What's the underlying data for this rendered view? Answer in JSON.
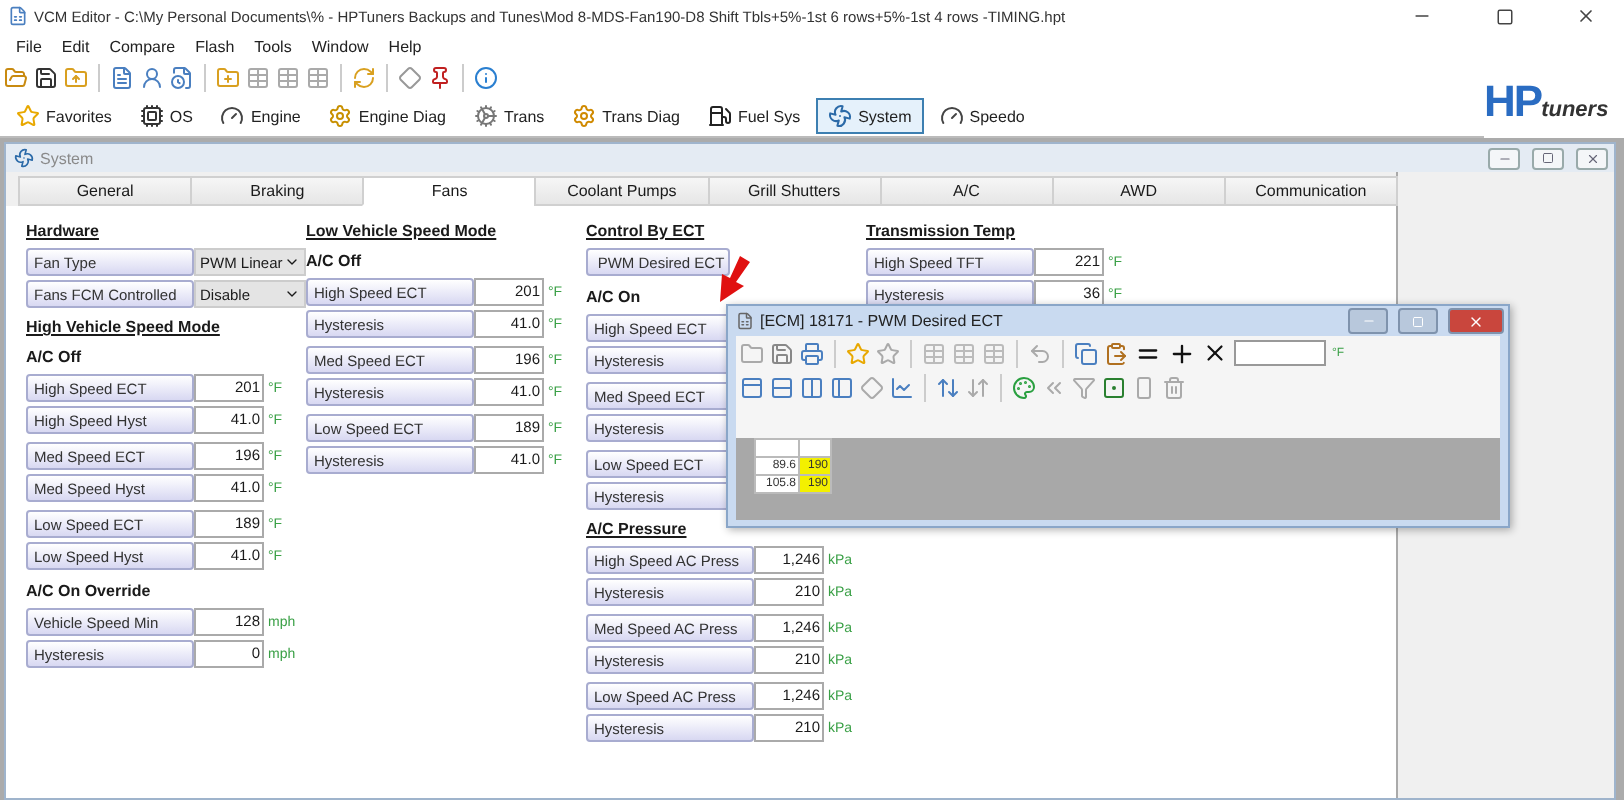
{
  "window": {
    "title": "VCM Editor - C:\\My Personal Documents\\% - HPTuners Backups and Tunes\\Mod 8-MDS-Fan190-D8 Shift Tbls+5%-1st 6 rows+5%-1st 4 rows -TIMING.hpt"
  },
  "menu": [
    "File",
    "Edit",
    "Compare",
    "Flash",
    "Tools",
    "Window",
    "Help"
  ],
  "logo": {
    "brand": "HP",
    "suffix": "tuners"
  },
  "modules": [
    {
      "label": "Favorites",
      "selected": false
    },
    {
      "label": "OS",
      "selected": false
    },
    {
      "label": "Engine",
      "selected": false
    },
    {
      "label": "Engine Diag",
      "selected": false
    },
    {
      "label": "Trans",
      "selected": false
    },
    {
      "label": "Trans Diag",
      "selected": false
    },
    {
      "label": "Fuel Sys",
      "selected": false
    },
    {
      "label": "System",
      "selected": true
    },
    {
      "label": "Speedo",
      "selected": false
    }
  ],
  "child_window": {
    "title": "System",
    "tabs": [
      {
        "label": "General",
        "selected": false
      },
      {
        "label": "Braking",
        "selected": false
      },
      {
        "label": "Fans",
        "selected": true
      },
      {
        "label": "Coolant Pumps",
        "selected": false
      },
      {
        "label": "Grill Shutters",
        "selected": false
      },
      {
        "label": "A/C",
        "selected": false
      },
      {
        "label": "AWD",
        "selected": false
      },
      {
        "label": "Communication",
        "selected": false
      }
    ],
    "columns": [
      {
        "items": [
          {
            "kind": "heading",
            "text": "Hardware"
          },
          {
            "kind": "group",
            "rows": [
              {
                "kind": "dropdown",
                "label": "Fan Type",
                "value": "PWM Linear"
              },
              {
                "kind": "dropdown",
                "label": "Fans FCM Controlled",
                "value": "Disable"
              }
            ]
          },
          {
            "kind": "heading",
            "text": "High Vehicle Speed Mode"
          },
          {
            "kind": "subheading",
            "text": "A/C Off"
          },
          {
            "kind": "group",
            "rows": [
              {
                "kind": "field",
                "label": "High Speed ECT",
                "value": "201",
                "unit": "°F"
              },
              {
                "kind": "field",
                "label": "High Speed Hyst",
                "value": "41.0",
                "unit": "°F"
              }
            ]
          },
          {
            "kind": "group",
            "rows": [
              {
                "kind": "field",
                "label": "Med Speed ECT",
                "value": "196",
                "unit": "°F"
              },
              {
                "kind": "field",
                "label": "Med Speed Hyst",
                "value": "41.0",
                "unit": "°F"
              }
            ]
          },
          {
            "kind": "group",
            "rows": [
              {
                "kind": "field",
                "label": "Low Speed ECT",
                "value": "189",
                "unit": "°F"
              },
              {
                "kind": "field",
                "label": "Low Speed Hyst",
                "value": "41.0",
                "unit": "°F"
              }
            ]
          },
          {
            "kind": "subheading",
            "text": "A/C On Override"
          },
          {
            "kind": "group",
            "rows": [
              {
                "kind": "field",
                "label": "Vehicle Speed Min",
                "value": "128",
                "unit": "mph"
              },
              {
                "kind": "field",
                "label": "Hysteresis",
                "value": "0",
                "unit": "mph"
              }
            ]
          }
        ]
      },
      {
        "items": [
          {
            "kind": "heading",
            "text": "Low Vehicle Speed Mode"
          },
          {
            "kind": "subheading",
            "text": "A/C Off"
          },
          {
            "kind": "group",
            "rows": [
              {
                "kind": "field",
                "label": "High Speed ECT",
                "value": "201",
                "unit": "°F"
              },
              {
                "kind": "field",
                "label": "Hysteresis",
                "value": "41.0",
                "unit": "°F"
              }
            ]
          },
          {
            "kind": "group",
            "rows": [
              {
                "kind": "field",
                "label": "Med Speed ECT",
                "value": "196",
                "unit": "°F"
              },
              {
                "kind": "field",
                "label": "Hysteresis",
                "value": "41.0",
                "unit": "°F"
              }
            ]
          },
          {
            "kind": "group",
            "rows": [
              {
                "kind": "field",
                "label": "Low Speed ECT",
                "value": "189",
                "unit": "°F"
              },
              {
                "kind": "field",
                "label": "Hysteresis",
                "value": "41.0",
                "unit": "°F"
              }
            ]
          }
        ]
      },
      {
        "items": [
          {
            "kind": "heading",
            "text": "Control By ECT"
          },
          {
            "kind": "group",
            "rows": [
              {
                "kind": "button",
                "label": "PWM Desired ECT"
              }
            ]
          },
          {
            "kind": "subheading",
            "text": "A/C On"
          },
          {
            "kind": "group",
            "rows": [
              {
                "kind": "field",
                "label": "High Speed ECT"
              },
              {
                "kind": "field",
                "label": "Hysteresis"
              }
            ]
          },
          {
            "kind": "group",
            "rows": [
              {
                "kind": "field",
                "label": "Med Speed ECT"
              },
              {
                "kind": "field",
                "label": "Hysteresis"
              }
            ]
          },
          {
            "kind": "group",
            "rows": [
              {
                "kind": "field",
                "label": "Low Speed ECT"
              },
              {
                "kind": "field",
                "label": "Hysteresis"
              }
            ]
          },
          {
            "kind": "heading",
            "text": "A/C Pressure"
          },
          {
            "kind": "group",
            "rows": [
              {
                "kind": "field",
                "label": "High Speed AC Press",
                "value": "1,246",
                "unit": "kPa"
              },
              {
                "kind": "field",
                "label": "Hysteresis",
                "value": "210",
                "unit": "kPa"
              }
            ]
          },
          {
            "kind": "group",
            "rows": [
              {
                "kind": "field",
                "label": "Med Speed AC Press",
                "value": "1,246",
                "unit": "kPa"
              },
              {
                "kind": "field",
                "label": "Hysteresis",
                "value": "210",
                "unit": "kPa"
              }
            ]
          },
          {
            "kind": "group",
            "rows": [
              {
                "kind": "field",
                "label": "Low Speed AC Press",
                "value": "1,246",
                "unit": "kPa"
              },
              {
                "kind": "field",
                "label": "Hysteresis",
                "value": "210",
                "unit": "kPa"
              }
            ]
          }
        ]
      },
      {
        "items": [
          {
            "kind": "heading",
            "text": "Transmission Temp"
          },
          {
            "kind": "group",
            "rows": [
              {
                "kind": "field",
                "label": "High Speed TFT",
                "value": "221",
                "unit": "°F"
              },
              {
                "kind": "field",
                "label": "Hysteresis",
                "value": "36",
                "unit": "°F"
              }
            ]
          }
        ]
      }
    ]
  },
  "table_window": {
    "title": "[ECM] 18171 - PWM Desired ECT",
    "unit": "°F",
    "rows": [
      {
        "axis": "89.6",
        "value": "190",
        "selected": true
      },
      {
        "axis": "105.8",
        "value": "190",
        "selected": true
      }
    ]
  }
}
